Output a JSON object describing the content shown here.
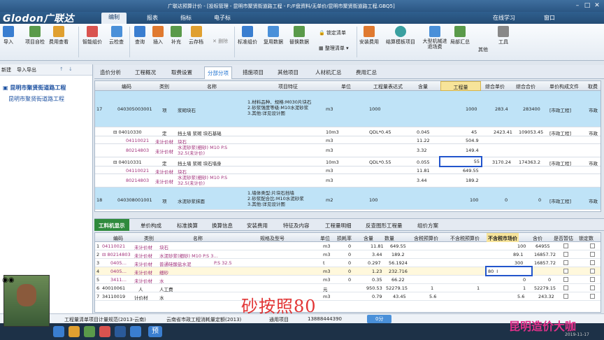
{
  "window": {
    "title": "广联达预算计价 - [投标管理 - 昆明市聚贤街道路工程 - F:/F盘资料/无单价/昆明市聚贤街道路工程.GBQ5]",
    "logo": "Glodon广联达",
    "menus": [
      "编制",
      "报表",
      "指标",
      "电子标"
    ],
    "right": [
      "在线学习",
      "窗口"
    ]
  },
  "ribbon": {
    "buttons": [
      "导入",
      "项目自检",
      "费用查看",
      "智能组价",
      "云检查",
      "查询",
      "插入",
      "补充",
      "云存档",
      "删除",
      "标准组价",
      "复用数据",
      "替换数据",
      "锁定清单",
      "整理清单",
      "安装费用",
      "结算模板项目",
      "大型机械进退场费",
      "局部汇总",
      "其他",
      "工具"
    ]
  },
  "leftpanel": {
    "tools": [
      "新建",
      "导入导出"
    ],
    "tree": [
      "昆明市聚贤街道路工程",
      "昆明市聚贤街道路工程"
    ]
  },
  "tabs": [
    "造价分析",
    "工程概况",
    "取费设置",
    "分部分项",
    "措施项目",
    "其他项目",
    "人材机汇总",
    "费用汇总"
  ],
  "grid": {
    "headers": [
      "编码",
      "类别",
      "名称",
      "项目特征",
      "单位",
      "工程量表达式",
      "含量",
      "工程量",
      "综合单价",
      "综合合价",
      "单价构成文件",
      "取费"
    ],
    "rows": [
      {
        "no": "17",
        "code": "040305003001",
        "type": "项",
        "name": "浆砌块石",
        "feature": "1.材料品种、规格:M030片块石\n2.砂浆强度等级:M10水泥砂浆\n3.其他:详见设计图",
        "unit": "m3",
        "expr": "1000",
        "content": "",
        "qty": "1000",
        "price": "283.4",
        "total": "283400",
        "file": "[市政工程]",
        "fee": "市政"
      },
      {
        "no": "",
        "code": "04010330",
        "type": "定",
        "name": "挡土墙 浆砌 块石基础",
        "feature": "",
        "unit": "10m3",
        "expr": "QDL*0.45",
        "content": "0.045",
        "qty": "45",
        "price": "2423.41",
        "total": "109053.45",
        "file": "[市政工程]",
        "fee": "市政"
      },
      {
        "no": "",
        "code": "04110021",
        "type": "未计价材",
        "name": "块石",
        "feature": "",
        "unit": "m3",
        "expr": "",
        "content": "11.22",
        "qty": "504.9",
        "price": "",
        "total": "",
        "file": "",
        "fee": ""
      },
      {
        "no": "",
        "code": "80214803",
        "type": "未计价材",
        "name": "水泥砂浆(细砂) M10 P.S 32.5(未计价)",
        "feature": "",
        "unit": "m3",
        "expr": "",
        "content": "3.32",
        "qty": "149.4",
        "price": "",
        "total": "",
        "file": "",
        "fee": ""
      },
      {
        "no": "",
        "code": "04010331",
        "type": "定",
        "name": "挡土墙 浆砌 块石墙身",
        "feature": "",
        "unit": "10m3",
        "expr": "QDL*0.55",
        "content": "0.055",
        "qty": "55",
        "price": "3170.24",
        "total": "174363.2",
        "file": "[市政工程]",
        "fee": "市政"
      },
      {
        "no": "",
        "code": "04110021",
        "type": "未计价材",
        "name": "块石",
        "feature": "",
        "unit": "m3",
        "expr": "",
        "content": "11.81",
        "qty": "649.55",
        "price": "",
        "total": "",
        "file": "",
        "fee": ""
      },
      {
        "no": "",
        "code": "80214803",
        "type": "未计价材",
        "name": "水泥砂浆(细砂) M10 P.S 32.5(未计价)",
        "feature": "",
        "unit": "m3",
        "expr": "",
        "content": "3.44",
        "qty": "189.2",
        "price": "",
        "total": "",
        "file": "",
        "fee": ""
      },
      {
        "no": "18",
        "code": "040308001001",
        "type": "项",
        "name": "水泥砂浆抹面",
        "feature": "1.墙体类型:片块石挡墙\n2.砂浆配合比:M10水泥砂浆\n3.其他:详见设计图",
        "unit": "m2",
        "expr": "100",
        "content": "",
        "qty": "100",
        "price": "0",
        "total": "0",
        "file": "[市政工程]",
        "fee": "市政"
      }
    ]
  },
  "lowtabs": [
    "工料机显示",
    "单价构成",
    "标准换算",
    "换算信息",
    "安装费用",
    "特征及内容",
    "工程量明细",
    "反查图形工程量",
    "组价方案"
  ],
  "lgrid": {
    "headers": [
      "编码",
      "类别",
      "名称",
      "规格及型号",
      "单位",
      "损耗率",
      "含量",
      "数量",
      "含税预算价",
      "不含税预算价",
      "不含税市场价",
      "含价",
      "是否暂估",
      "锁定数"
    ],
    "rows": [
      {
        "no": "1",
        "code": "04110021",
        "type": "未计价材",
        "name": "块石",
        "spec": "",
        "unit": "m3",
        "loss": "0",
        "content": "11.81",
        "qty": "649.55",
        "tax": "",
        "notax": "",
        "market": "100",
        "price": "64955"
      },
      {
        "no": "2",
        "code": "80214803",
        "type": "未计价材",
        "name": "水泥砂浆(细砂) M10 P.S 3…",
        "spec": "",
        "unit": "m3",
        "loss": "0",
        "content": "3.44",
        "qty": "189.2",
        "tax": "",
        "notax": "",
        "market": "89.1",
        "price": "16857.72"
      },
      {
        "no": "3",
        "code": "0405…",
        "type": "未计价材",
        "name": "普通硅酸盐水泥",
        "spec": "P.S 32.5",
        "unit": "t",
        "loss": "0",
        "content": "0.297",
        "qty": "56.1924",
        "tax": "",
        "notax": "",
        "market": "300",
        "price": "16857.72"
      },
      {
        "no": "4",
        "code": "0405…",
        "type": "未计价材",
        "name": "细砂",
        "spec": "",
        "unit": "m3",
        "loss": "0",
        "content": "1.23",
        "qty": "232.716",
        "tax": "",
        "notax": "",
        "market": "80",
        "price": ""
      },
      {
        "no": "5",
        "code": "3411…",
        "type": "未计价材",
        "name": "水",
        "spec": "",
        "unit": "m3",
        "loss": "0",
        "content": "0.35",
        "qty": "66.22",
        "tax": "",
        "notax": "",
        "market": "0",
        "price": "0"
      },
      {
        "no": "6",
        "code": "40010061",
        "type": "人",
        "name": "人工费",
        "spec": "",
        "unit": "元",
        "loss": "",
        "content": "950.53",
        "qty": "52279.15",
        "tax": "1",
        "notax": "1",
        "market": "1",
        "price": "52279.15"
      },
      {
        "no": "7",
        "code": "34110019",
        "type": "计价材",
        "name": "水",
        "spec": "",
        "unit": "m3",
        "loss": "",
        "content": "0.79",
        "qty": "43.45",
        "tax": "5.6",
        "notax": "",
        "market": "5.6",
        "price": "243.32"
      }
    ]
  },
  "status": [
    "工程量清单项目计量规范(2013-云南)",
    "云南省市政工程消耗量定额(2013)",
    "通用项目",
    "13888444390",
    "0分"
  ],
  "watermark": "砂按照80",
  "brand": "昆明造价大咖",
  "clock": "2019-11-17"
}
